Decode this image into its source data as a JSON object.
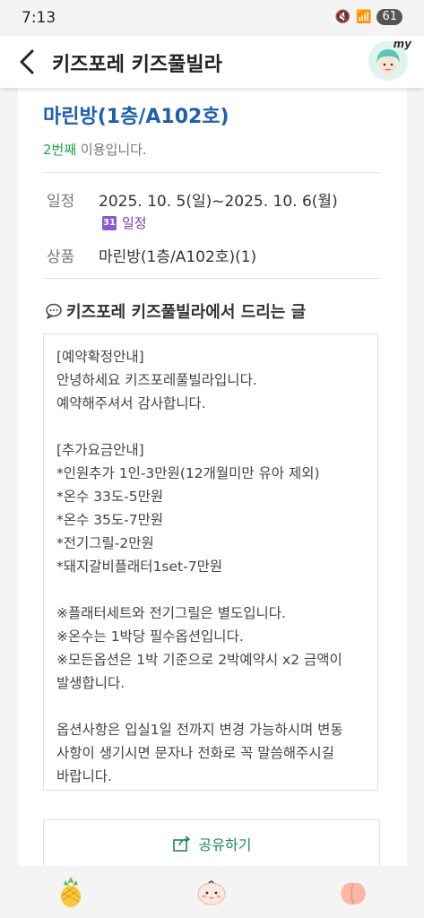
{
  "status_bar": {
    "time": "7:13",
    "battery": "61"
  },
  "header": {
    "title": "키즈포레 키즈풀빌라",
    "avatar_badge": "my"
  },
  "booking": {
    "room_title": "마린방(1층/A102호)",
    "visit_count": "2번째",
    "visit_suffix": " 이용입니다.",
    "schedule_label": "일정",
    "schedule_value": "2025. 10. 5(일)~2025. 10. 6(월)",
    "calendar_link": "일정",
    "calendar_day": "31",
    "product_label": "상품",
    "product_value": "마린방(1층/A102호)(1)"
  },
  "message": {
    "heading": "키즈포레 키즈풀빌라에서 드리는 글",
    "body": "[예약확정안내]\n안녕하세요 키즈포레풀빌라입니다.\n예약해주셔서 감사합니다.\n\n[추가요금안내]\n*인원추가 1인-3만원(12개월미만 유아 제외)\n*온수 33도-5만원\n*온수 35도-7만원\n*전기그릴-2만원\n*돼지갈비플래터1set-7만원\n\n※플래터세트와 전기그릴은 별도입니다.\n※온수는 1박당 필수옵션입니다.\n※모든옵션은 1박 기준으로 2박예약시 x2 금액이\n발생합니다.\n\n옵션사항은 입실1일 전까지 변경 가능하시며 변동\n사항이 생기시면 문자나 전화로 꼭 말씀해주시길\n바랍니다."
  },
  "share_button": {
    "label": "공유하기"
  },
  "bottom_nav": [
    {
      "icon": "pineapple-icon"
    },
    {
      "icon": "baby-face-icon"
    },
    {
      "icon": "peach-icon"
    }
  ],
  "colors": {
    "link_blue": "#1f5fae",
    "green": "#1ea54a",
    "purple": "#6f3fb6"
  }
}
